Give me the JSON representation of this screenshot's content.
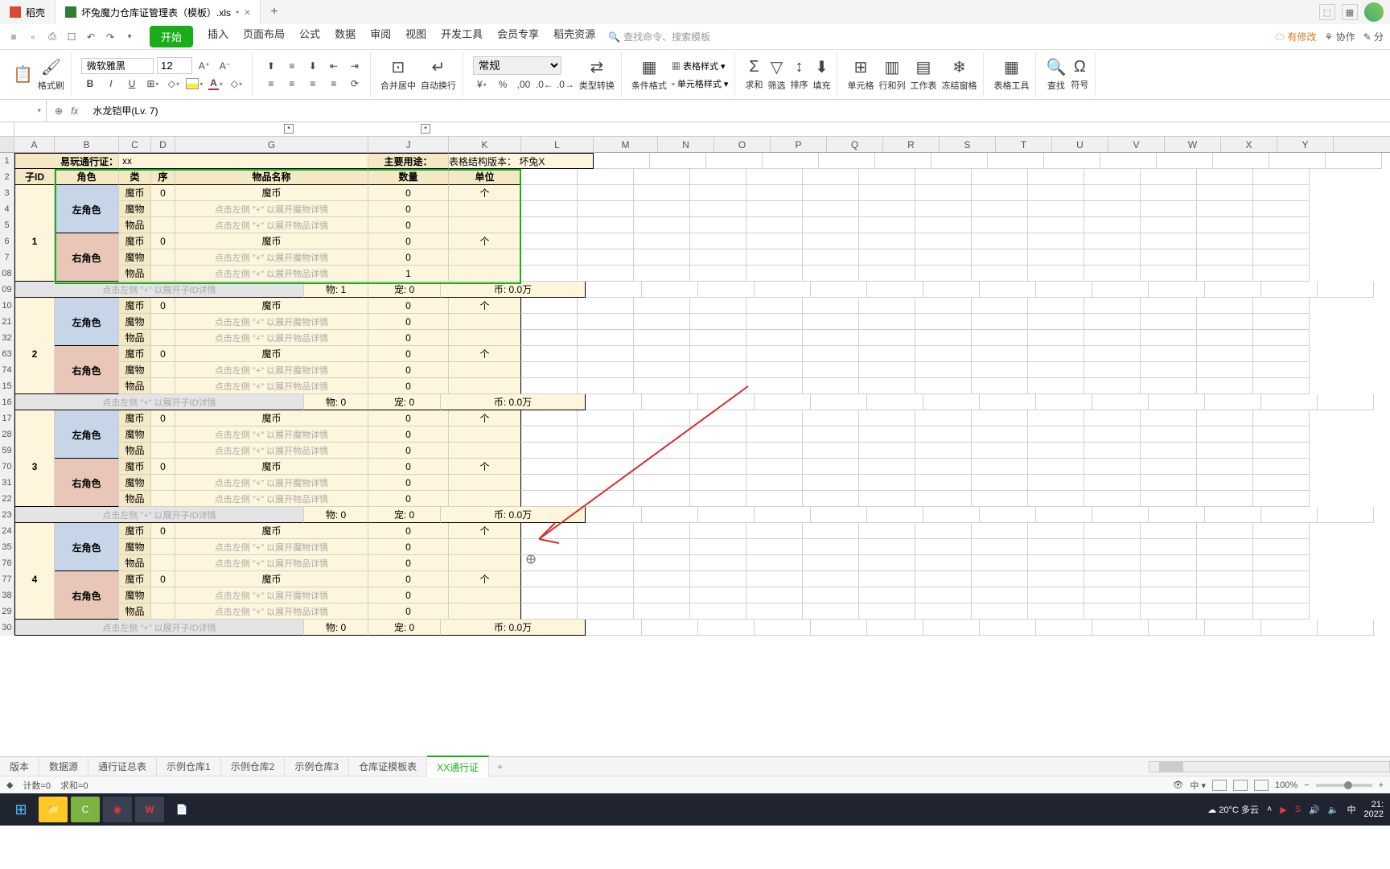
{
  "titlebar": {
    "tab1": "稻壳",
    "tab2": "坏兔魔力仓库证管理表（模板）.xls",
    "tab2_modified": "•"
  },
  "menu": {
    "tabs": [
      "开始",
      "插入",
      "页面布局",
      "公式",
      "数据",
      "审阅",
      "视图",
      "开发工具",
      "会员专享",
      "稻壳资源"
    ],
    "search_placeholder": "查找命令、搜索模板",
    "cloud": "有修改",
    "coop": "协作",
    "share": "分"
  },
  "ribbon": {
    "fmt_brush": "格式刷",
    "font": "微软雅黑",
    "size": "12",
    "merge": "合并居中",
    "wrap": "自动换行",
    "numfmt": "常规",
    "typeconv": "类型转换",
    "condfmt": "条件格式",
    "tablestyle": "表格样式",
    "cellstyle": "单元格样式",
    "sum": "求和",
    "filter": "筛选",
    "sort": "排序",
    "fill": "填充",
    "cell": "单元格",
    "rowcol": "行和列",
    "sheet": "工作表",
    "freeze": "冻结窗格",
    "tabletool": "表格工具",
    "find": "查找",
    "symbol": "符号"
  },
  "formula": {
    "namebox": "",
    "text": "水龙铠甲(Lv. 7)"
  },
  "headers": {
    "cols": [
      "A",
      "B",
      "C",
      "D",
      "G",
      "J",
      "K",
      "L",
      "M",
      "N",
      "O",
      "P",
      "Q",
      "R",
      "S",
      "T",
      "U",
      "V",
      "W",
      "X",
      "Y"
    ],
    "pass": "易玩通行证：",
    "pass_val": "xx",
    "use": "主要用途：",
    "struct": "表格结构版本：",
    "struct_val": "坏兔X",
    "sub_id": "子ID",
    "role": "角色",
    "type": "类",
    "seq": "序",
    "item": "物品名称",
    "qty": "数量",
    "unit": "单位"
  },
  "labels": {
    "left_role": "左角色",
    "right_role": "右角色",
    "coin": "魔币",
    "monster": "魔物",
    "item": "物品",
    "unit_ge": "个",
    "hint_monster": "点击左侧 \"+\" 以展开魔物详情",
    "hint_item": "点击左侧 \"+\" 以展开物品详情",
    "hint_id": "点击左侧 \"+\" 以展开子ID详情"
  },
  "groups": [
    {
      "id": "1",
      "rows": [
        "3",
        "4",
        "5",
        "6",
        "7",
        "08"
      ],
      "summary_row": "09",
      "wu": "物: 1",
      "chong": "宠: 0",
      "bi": "币: 0.0万",
      "item_qty": "1"
    },
    {
      "id": "2",
      "rows": [
        "10",
        "21",
        "32",
        "63",
        "74",
        "15"
      ],
      "summary_row": "16",
      "wu": "物: 0",
      "chong": "宠: 0",
      "bi": "币: 0.0万",
      "item_qty": "0"
    },
    {
      "id": "3",
      "rows": [
        "17",
        "28",
        "59",
        "70",
        "31",
        "22"
      ],
      "summary_row": "23",
      "wu": "物: 0",
      "chong": "宠: 0",
      "bi": "币: 0.0万",
      "item_qty": "0"
    },
    {
      "id": "4",
      "rows": [
        "24",
        "35",
        "76",
        "77",
        "38",
        "29"
      ],
      "summary_row": "30",
      "wu": "物: 0",
      "chong": "宠: 0",
      "bi": "币: 0.0万",
      "item_qty": "0"
    }
  ],
  "sheets": [
    "版本",
    "数据源",
    "通行证总表",
    "示例仓库1",
    "示例仓库2",
    "示例仓库3",
    "仓库证模板表",
    "XX通行证"
  ],
  "status": {
    "count": "计数=0",
    "sum": "求和=0",
    "zoom": "100%"
  },
  "tray": {
    "weather": "20°C 多云",
    "ime": "中",
    "time": "21:",
    "date": "2022"
  }
}
